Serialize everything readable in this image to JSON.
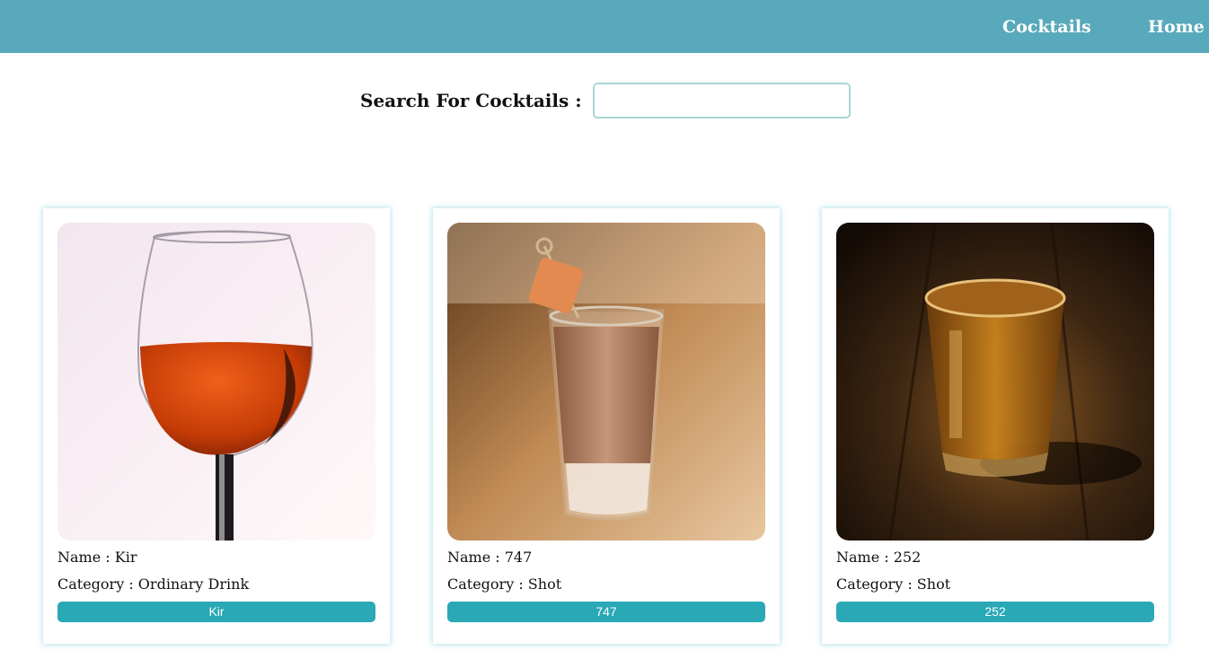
{
  "nav": {
    "links": [
      {
        "label": "Cocktails"
      },
      {
        "label": "Home"
      }
    ]
  },
  "search": {
    "label": "Search For Cocktails :",
    "value": "",
    "placeholder": ""
  },
  "cocktails": [
    {
      "name_line": "Name : Kir",
      "category_line": "Category : Ordinary Drink",
      "button_label": "Kir"
    },
    {
      "name_line": "Name : 747",
      "category_line": "Category : Shot",
      "button_label": "747"
    },
    {
      "name_line": "Name : 252",
      "category_line": "Category : Shot",
      "button_label": "252"
    }
  ],
  "colors": {
    "navbar": "#57a9bb",
    "button": "#2aa8b6",
    "input_border": "#a9d6d8"
  }
}
